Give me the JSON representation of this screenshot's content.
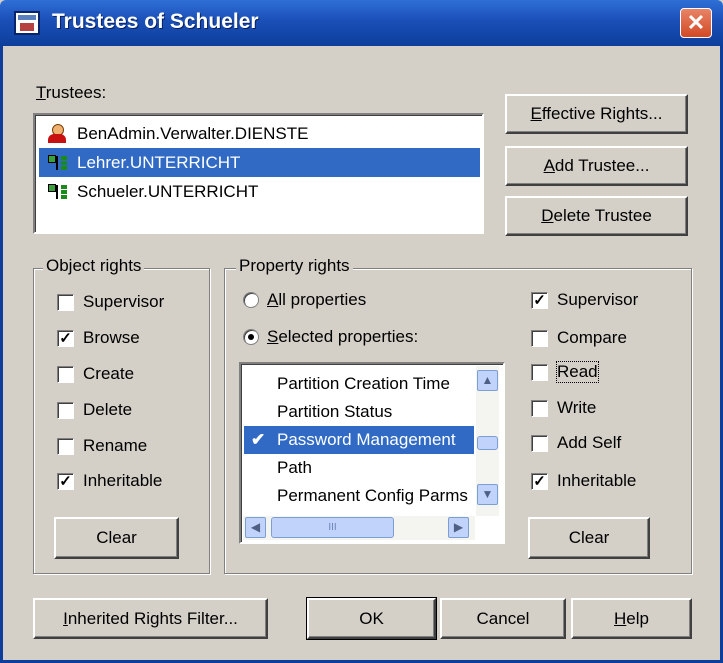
{
  "window": {
    "title": "Trustees of Schueler",
    "close_label": "✕"
  },
  "trustees": {
    "label_mnemonic": "T",
    "label_rest": "rustees:",
    "items": [
      {
        "name": "BenAdmin.Verwalter.DIENSTE",
        "icon": "user-icon",
        "selected": false
      },
      {
        "name": "Lehrer.UNTERRICHT",
        "icon": "organizational-unit-icon",
        "selected": true
      },
      {
        "name": "Schueler.UNTERRICHT",
        "icon": "organizational-unit-icon",
        "selected": false
      }
    ]
  },
  "buttons": {
    "effective_rights": {
      "mnemonic": "E",
      "rest": "ffective Rights..."
    },
    "add_trustee": {
      "mnemonic": "A",
      "rest": "dd Trustee..."
    },
    "delete_trustee": {
      "mnemonic": "D",
      "rest": "elete Trustee"
    },
    "object_clear": "Clear",
    "property_clear": "Clear",
    "inherited_filter": {
      "mnemonic": "I",
      "rest": "nherited Rights Filter..."
    },
    "ok": "OK",
    "cancel": "Cancel",
    "help": {
      "mnemonic": "H",
      "rest": "elp"
    }
  },
  "object_rights": {
    "title": "Object rights",
    "items": [
      {
        "label": "Supervisor",
        "checked": false
      },
      {
        "label": "Browse",
        "checked": true
      },
      {
        "label": "Create",
        "checked": false
      },
      {
        "label": "Delete",
        "checked": false
      },
      {
        "label": "Rename",
        "checked": false
      },
      {
        "label": "Inheritable",
        "checked": true
      }
    ]
  },
  "property_rights": {
    "title": "Property rights",
    "all_properties": {
      "mnemonic": "A",
      "rest": "ll properties",
      "selected": false
    },
    "selected_properties": {
      "mnemonic": "S",
      "rest": "elected properties:",
      "selected": true
    },
    "properties": [
      {
        "label": "Partition Creation Time",
        "checked": false,
        "selected": false
      },
      {
        "label": "Partition Status",
        "checked": false,
        "selected": false
      },
      {
        "label": "Password Management",
        "checked": true,
        "selected": true
      },
      {
        "label": "Path",
        "checked": false,
        "selected": false
      },
      {
        "label": "Permanent Config Parms",
        "checked": false,
        "selected": false
      }
    ],
    "rights": [
      {
        "label": "Supervisor",
        "checked": true
      },
      {
        "label": "Compare",
        "checked": false
      },
      {
        "label": "Read",
        "checked": false
      },
      {
        "label": "Write",
        "checked": false
      },
      {
        "label": "Add Self",
        "checked": false
      },
      {
        "label": "Inheritable",
        "checked": true
      }
    ]
  },
  "icons": {
    "check_mark": "✔",
    "scroll_up": "▲",
    "scroll_down": "▼",
    "scroll_left": "◀",
    "scroll_right": "▶",
    "thumb_grip": "III"
  }
}
